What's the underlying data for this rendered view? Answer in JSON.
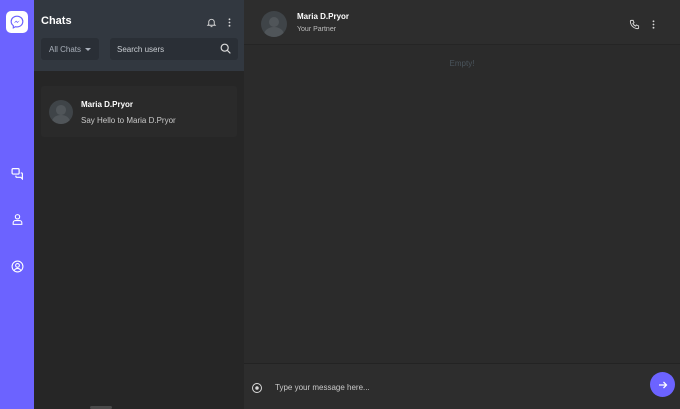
{
  "app": {
    "name": "Messenger",
    "accent": "#6c63ff"
  },
  "rail": {
    "items": [
      {
        "name": "chats",
        "icon": "chat-bubbles-icon"
      },
      {
        "name": "contacts",
        "icon": "people-icon"
      },
      {
        "name": "profile",
        "icon": "user-circle-icon"
      }
    ]
  },
  "chat_panel": {
    "title": "Chats",
    "filter_label": "All Chats",
    "search_placeholder": "Search users",
    "items": [
      {
        "name": "Maria D.Pryor",
        "preview": "Say Hello to Maria D.Pryor"
      }
    ]
  },
  "conversation": {
    "contact_name": "Maria D.Pryor",
    "contact_subtitle": "Your Partner",
    "empty_text": "Empty!",
    "message_placeholder": "Type your message here..."
  }
}
